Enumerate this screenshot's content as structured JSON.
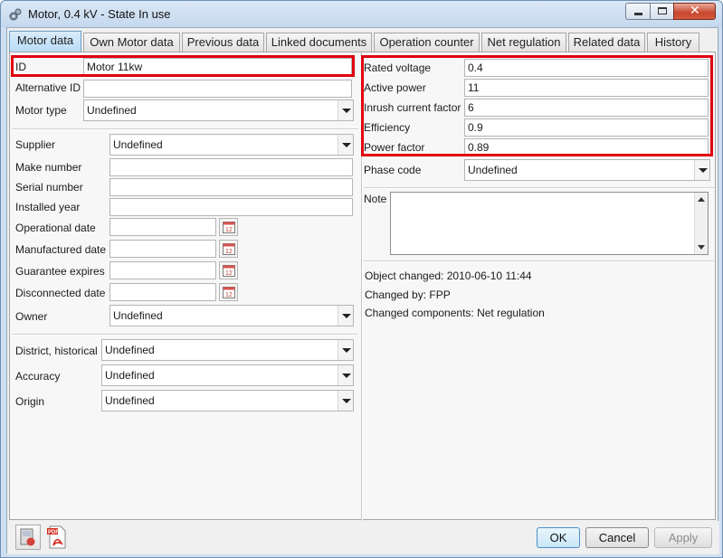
{
  "window": {
    "title": "Motor, 0.4 kV - State In use"
  },
  "tabs": [
    {
      "label": "Motor data"
    },
    {
      "label": "Own Motor data"
    },
    {
      "label": "Previous data"
    },
    {
      "label": "Linked documents"
    },
    {
      "label": "Operation counter"
    },
    {
      "label": "Net regulation"
    },
    {
      "label": "Related data"
    },
    {
      "label": "History"
    }
  ],
  "left": {
    "id_label": "ID",
    "id_value": "Motor 11kw",
    "alt_id_label": "Alternative ID",
    "alt_id_value": "",
    "motor_type_label": "Motor type",
    "motor_type_value": "Undefined",
    "supplier_label": "Supplier",
    "supplier_value": "Undefined",
    "make_number_label": "Make number",
    "make_number_value": "",
    "serial_number_label": "Serial number",
    "serial_number_value": "",
    "installed_year_label": "Installed year",
    "installed_year_value": "",
    "operational_date_label": "Operational date",
    "operational_date_value": "",
    "manufactured_date_label": "Manufactured date",
    "manufactured_date_value": "",
    "guarantee_expires_label": "Guarantee expires",
    "guarantee_expires_value": "",
    "disconnected_date_label": "Disconnected date",
    "disconnected_date_value": "",
    "owner_label": "Owner",
    "owner_value": "Undefined",
    "district_label": "District, historical",
    "district_value": "Undefined",
    "accuracy_label": "Accuracy",
    "accuracy_value": "Undefined",
    "origin_label": "Origin",
    "origin_value": "Undefined"
  },
  "right": {
    "rated_voltage_label": "Rated voltage",
    "rated_voltage_value": "0.4",
    "active_power_label": "Active power",
    "active_power_value": "11",
    "inrush_label": "Inrush current factor",
    "inrush_value": "6",
    "efficiency_label": "Efficiency",
    "efficiency_value": "0.9",
    "power_factor_label": "Power factor",
    "power_factor_value": "0.89",
    "phase_code_label": "Phase code",
    "phase_code_value": "Undefined",
    "note_label": "Note",
    "note_value": "",
    "object_changed": "Object changed: 2010-06-10 11:44",
    "changed_by": "Changed by: FPP",
    "changed_components": "Changed components: Net regulation"
  },
  "buttons": {
    "ok": "OK",
    "cancel": "Cancel",
    "apply": "Apply"
  },
  "colors": {
    "highlight": "#e0000f",
    "active_tab": "#b9dcf6",
    "title_bar": "#c4d8ee"
  },
  "icons": [
    "motor-app-icon",
    "minimize-icon",
    "maximize-icon",
    "close-icon",
    "calendar-icon",
    "report-icon",
    "pdf-icon"
  ]
}
